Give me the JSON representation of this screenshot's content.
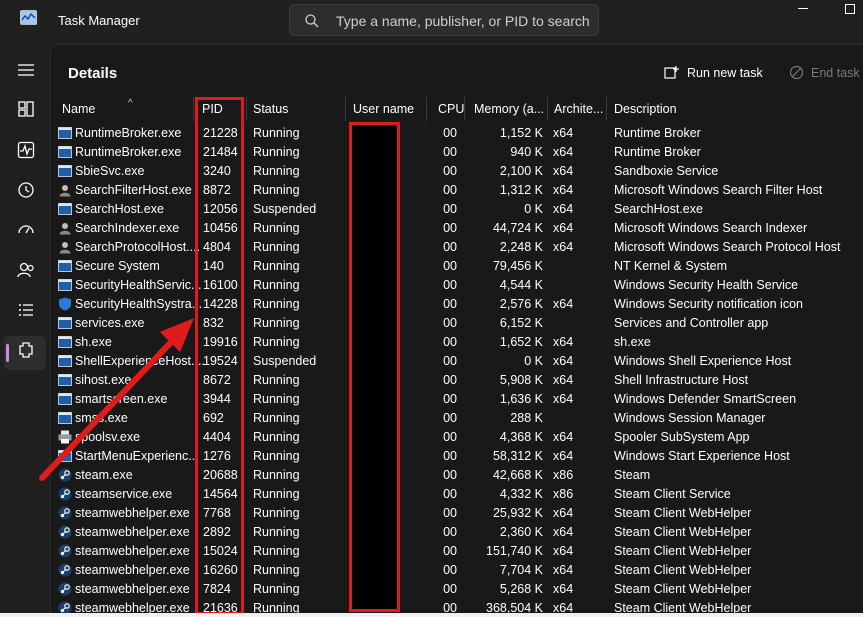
{
  "app": {
    "title": "Task Manager"
  },
  "search": {
    "placeholder": "Type a name, publisher, or PID to search"
  },
  "sidebar": {
    "items": [
      {
        "name": "hamburger-menu-icon"
      },
      {
        "name": "processes-icon"
      },
      {
        "name": "performance-icon"
      },
      {
        "name": "app-history-icon"
      },
      {
        "name": "startup-apps-icon"
      },
      {
        "name": "users-icon"
      },
      {
        "name": "details-icon",
        "active": true
      },
      {
        "name": "services-icon"
      }
    ]
  },
  "page": {
    "title": "Details",
    "run_new_task": "Run new task",
    "end_task": "End task"
  },
  "table": {
    "columns": [
      "Name",
      "PID",
      "Status",
      "User name",
      "CPU",
      "Memory (a...",
      "Archite...",
      "Description"
    ],
    "rows": [
      {
        "name": "RuntimeBroker.exe",
        "pid": "21228",
        "status": "Running",
        "cpu": "00",
        "mem": "1,152 K",
        "arch": "x64",
        "desc": "Runtime Broker",
        "icon": "app-window-icon"
      },
      {
        "name": "RuntimeBroker.exe",
        "pid": "21484",
        "status": "Running",
        "cpu": "00",
        "mem": "940 K",
        "arch": "x64",
        "desc": "Runtime Broker",
        "icon": "app-window-icon"
      },
      {
        "name": "SbieSvc.exe",
        "pid": "3240",
        "status": "Running",
        "cpu": "00",
        "mem": "2,100 K",
        "arch": "x64",
        "desc": "Sandboxie Service",
        "icon": "app-window-icon"
      },
      {
        "name": "SearchFilterHost.exe",
        "pid": "8872",
        "status": "Running",
        "cpu": "00",
        "mem": "1,312 K",
        "arch": "x64",
        "desc": "Microsoft Windows Search Filter Host",
        "icon": "search-user-icon"
      },
      {
        "name": "SearchHost.exe",
        "pid": "12056",
        "status": "Suspended",
        "cpu": "00",
        "mem": "0 K",
        "arch": "x64",
        "desc": "SearchHost.exe",
        "icon": "app-window-icon"
      },
      {
        "name": "SearchIndexer.exe",
        "pid": "10456",
        "status": "Running",
        "cpu": "00",
        "mem": "44,724 K",
        "arch": "x64",
        "desc": "Microsoft Windows Search Indexer",
        "icon": "search-user-icon"
      },
      {
        "name": "SearchProtocolHost....",
        "pid": "4804",
        "status": "Running",
        "cpu": "00",
        "mem": "2,248 K",
        "arch": "x64",
        "desc": "Microsoft Windows Search Protocol Host",
        "icon": "search-user-icon"
      },
      {
        "name": "Secure System",
        "pid": "140",
        "status": "Running",
        "cpu": "00",
        "mem": "79,456 K",
        "arch": "",
        "desc": "NT Kernel & System",
        "icon": "app-window-icon"
      },
      {
        "name": "SecurityHealthServic...",
        "pid": "16100",
        "status": "Running",
        "cpu": "00",
        "mem": "4,544 K",
        "arch": "",
        "desc": "Windows Security Health Service",
        "icon": "app-window-icon"
      },
      {
        "name": "SecurityHealthSystra...",
        "pid": "14228",
        "status": "Running",
        "cpu": "00",
        "mem": "2,576 K",
        "arch": "x64",
        "desc": "Windows Security notification icon",
        "icon": "shield-icon"
      },
      {
        "name": "services.exe",
        "pid": "832",
        "status": "Running",
        "cpu": "00",
        "mem": "6,152 K",
        "arch": "",
        "desc": "Services and Controller app",
        "icon": "app-window-icon"
      },
      {
        "name": "sh.exe",
        "pid": "19916",
        "status": "Running",
        "cpu": "00",
        "mem": "1,652 K",
        "arch": "x64",
        "desc": "sh.exe",
        "icon": "app-window-icon"
      },
      {
        "name": "ShellExperienceHost....",
        "pid": "19524",
        "status": "Suspended",
        "cpu": "00",
        "mem": "0 K",
        "arch": "x64",
        "desc": "Windows Shell Experience Host",
        "icon": "app-window-icon"
      },
      {
        "name": "sihost.exe",
        "pid": "8672",
        "status": "Running",
        "cpu": "00",
        "mem": "5,908 K",
        "arch": "x64",
        "desc": "Shell Infrastructure Host",
        "icon": "app-window-icon"
      },
      {
        "name": "smartscreen.exe",
        "pid": "3944",
        "status": "Running",
        "cpu": "00",
        "mem": "1,636 K",
        "arch": "x64",
        "desc": "Windows Defender SmartScreen",
        "icon": "app-window-icon"
      },
      {
        "name": "smss.exe",
        "pid": "692",
        "status": "Running",
        "cpu": "00",
        "mem": "288 K",
        "arch": "",
        "desc": "Windows Session Manager",
        "icon": "app-window-icon"
      },
      {
        "name": "spoolsv.exe",
        "pid": "4404",
        "status": "Running",
        "cpu": "00",
        "mem": "4,368 K",
        "arch": "x64",
        "desc": "Spooler SubSystem App",
        "icon": "printer-icon"
      },
      {
        "name": "StartMenuExperienc...",
        "pid": "1276",
        "status": "Running",
        "cpu": "00",
        "mem": "58,312 K",
        "arch": "x64",
        "desc": "Windows Start Experience Host",
        "icon": "app-window-icon"
      },
      {
        "name": "steam.exe",
        "pid": "20688",
        "status": "Running",
        "cpu": "00",
        "mem": "42,668 K",
        "arch": "x86",
        "desc": "Steam",
        "icon": "steam-icon"
      },
      {
        "name": "steamservice.exe",
        "pid": "14564",
        "status": "Running",
        "cpu": "00",
        "mem": "4,332 K",
        "arch": "x86",
        "desc": "Steam Client Service",
        "icon": "steam-icon"
      },
      {
        "name": "steamwebhelper.exe",
        "pid": "7768",
        "status": "Running",
        "cpu": "00",
        "mem": "25,932 K",
        "arch": "x64",
        "desc": "Steam Client WebHelper",
        "icon": "steam-icon"
      },
      {
        "name": "steamwebhelper.exe",
        "pid": "2892",
        "status": "Running",
        "cpu": "00",
        "mem": "2,360 K",
        "arch": "x64",
        "desc": "Steam Client WebHelper",
        "icon": "steam-icon"
      },
      {
        "name": "steamwebhelper.exe",
        "pid": "15024",
        "status": "Running",
        "cpu": "00",
        "mem": "151,740 K",
        "arch": "x64",
        "desc": "Steam Client WebHelper",
        "icon": "steam-icon"
      },
      {
        "name": "steamwebhelper.exe",
        "pid": "16260",
        "status": "Running",
        "cpu": "00",
        "mem": "7,704 K",
        "arch": "x64",
        "desc": "Steam Client WebHelper",
        "icon": "steam-icon"
      },
      {
        "name": "steamwebhelper.exe",
        "pid": "7824",
        "status": "Running",
        "cpu": "00",
        "mem": "5,268 K",
        "arch": "x64",
        "desc": "Steam Client WebHelper",
        "icon": "steam-icon"
      },
      {
        "name": "steamwebhelper.exe",
        "pid": "21636",
        "status": "Running",
        "cpu": "00",
        "mem": "368,504 K",
        "arch": "x64",
        "desc": "Steam Client WebHelper",
        "icon": "steam-icon"
      }
    ]
  },
  "annotations": {
    "highlight_color": "#e01b1b",
    "redaction_color": "#000000"
  },
  "colors": {
    "background": "#202020",
    "panel": "#191919",
    "active_accent": "#c88fe0"
  }
}
